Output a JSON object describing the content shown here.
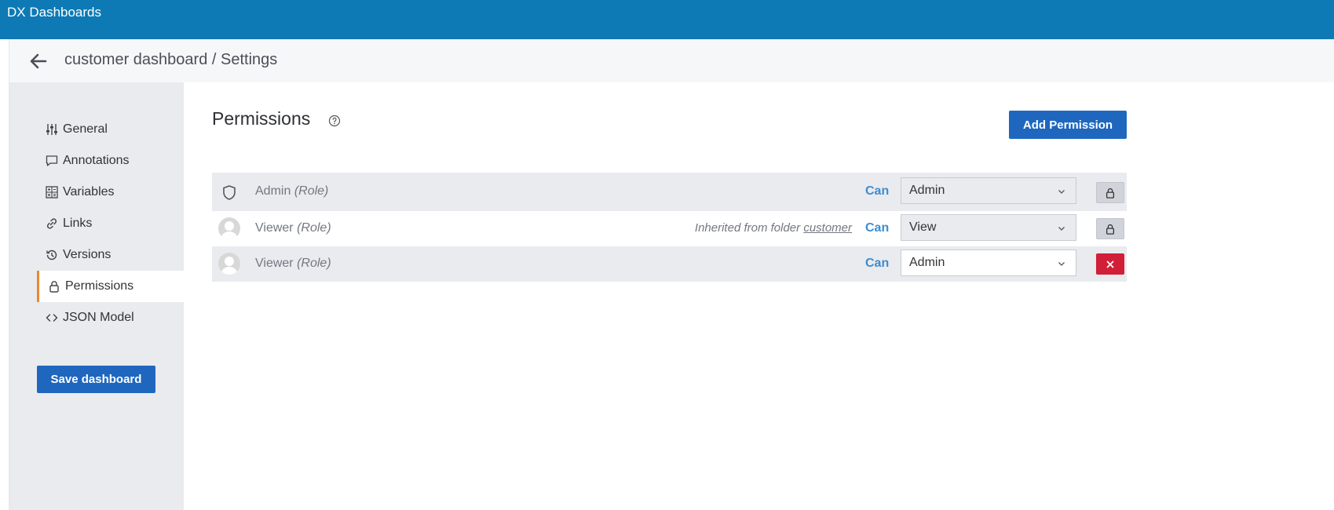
{
  "app": {
    "title": "DX Dashboards"
  },
  "header": {
    "breadcrumb": "customer dashboard / Settings",
    "back_icon": "arrow-left-icon"
  },
  "sidebar": {
    "items": [
      {
        "label": "General",
        "icon": "sliders-icon",
        "active": false
      },
      {
        "label": "Annotations",
        "icon": "comment-icon",
        "active": false
      },
      {
        "label": "Variables",
        "icon": "calculator-icon",
        "active": false
      },
      {
        "label": "Links",
        "icon": "link-icon",
        "active": false
      },
      {
        "label": "Versions",
        "icon": "history-icon",
        "active": true
      },
      {
        "label": "Permissions",
        "icon": "lock-icon",
        "active": true
      },
      {
        "label": "JSON Model",
        "icon": "code-icon",
        "active": false
      }
    ],
    "save_label": "Save dashboard"
  },
  "main": {
    "title": "Permissions",
    "add_label": "Add Permission",
    "can_label": "Can",
    "rows": [
      {
        "name": "Admin",
        "type": "(Role)",
        "icon": "shield-icon",
        "permission": "Admin",
        "inherited": "",
        "locked": true
      },
      {
        "name": "Viewer",
        "type": "(Role)",
        "icon": "avatar-icon",
        "permission": "View",
        "inherited_prefix": "Inherited from folder",
        "inherited_folder": "customer",
        "locked": true
      },
      {
        "name": "Viewer",
        "type": "(Role)",
        "icon": "avatar-icon",
        "permission": "Admin",
        "inherited": "",
        "locked": false
      }
    ]
  },
  "colors": {
    "topbar": "#0e7ab5",
    "primary_button": "#1f67be",
    "danger": "#d11f38",
    "active_accent": "#e8892b",
    "can_text": "#3d8dd0"
  }
}
